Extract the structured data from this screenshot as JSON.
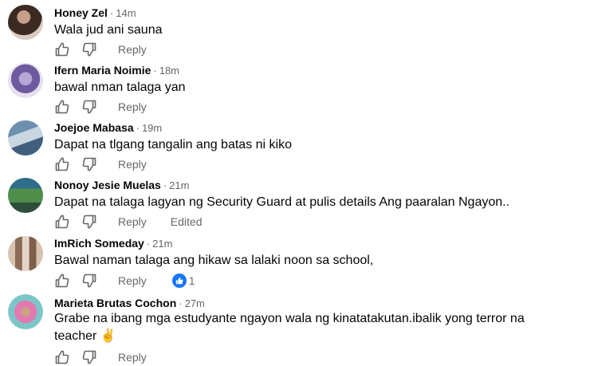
{
  "accent_color": "#1877f2",
  "comments": [
    {
      "author": "Honey Zel",
      "time": "14m",
      "text": "Wala jud ani sauna",
      "reply": "Reply"
    },
    {
      "author": "Ifern Maria Noimie",
      "time": "18m",
      "text": "bawal nman talaga yan",
      "reply": "Reply"
    },
    {
      "author": "Joejoe Mabasa",
      "time": "19m",
      "text": "Dapat na tlgang tangalin ang batas ni kiko",
      "reply": "Reply"
    },
    {
      "author": "Nonoy Jesie Muelas",
      "time": "21m",
      "text": "Dapat na talaga lagyan ng Security Guard at pulis details Ang paaralan Ngayon..",
      "reply": "Reply",
      "edited": "Edited"
    },
    {
      "author": "ImRich Someday",
      "time": "21m",
      "text": "Bawal naman talaga ang hikaw sa lalaki noon sa school,",
      "reply": "Reply",
      "reaction_count": "1"
    },
    {
      "author": "Marieta Brutas Cochon",
      "time": "27m",
      "text": "Grabe na ibang mga estudyante ngayon wala ng kinatatakutan.ibalik yong terror na teacher ✌",
      "reply": "Reply"
    }
  ]
}
